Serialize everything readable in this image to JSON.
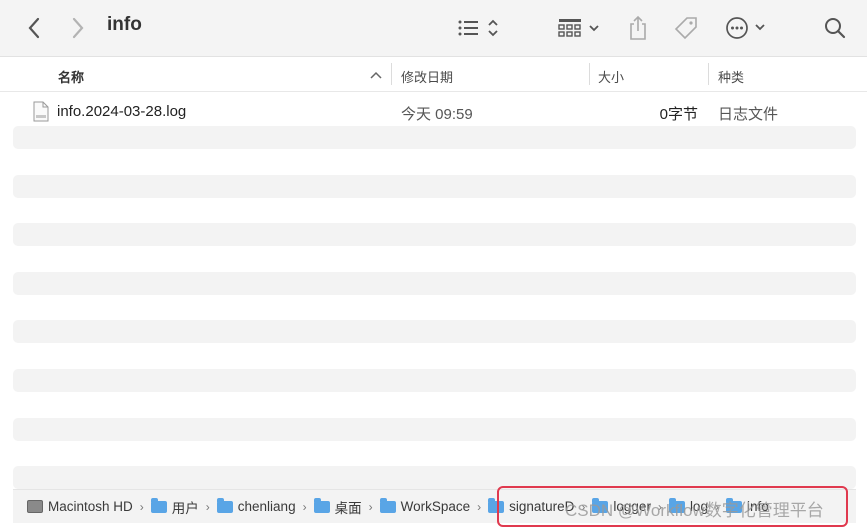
{
  "window": {
    "title": "info"
  },
  "toolbar": {
    "back_icon": "chevron-left-icon",
    "forward_icon": "chevron-right-icon",
    "view_list_icon": "list-view-icon",
    "group_icon": "grid-group-icon",
    "share_icon": "share-icon",
    "tag_icon": "tag-icon",
    "more_icon": "ellipsis-circle-icon",
    "search_icon": "search-icon"
  },
  "columns": {
    "name": "名称",
    "modified": "修改日期",
    "size": "大小",
    "kind": "种类"
  },
  "files": [
    {
      "name": "info.2024-03-28.log",
      "modified": "今天 09:59",
      "size": "0字节",
      "kind": "日志文件"
    }
  ],
  "pathbar": {
    "items": [
      {
        "label": "Macintosh HD",
        "icon": "hard-drive-icon"
      },
      {
        "label": "用户",
        "icon": "folder-icon"
      },
      {
        "label": "chenliang",
        "icon": "home-folder-icon"
      },
      {
        "label": "桌面",
        "icon": "folder-icon"
      },
      {
        "label": "WorkSpace",
        "icon": "folder-icon"
      },
      {
        "label": "signatureD",
        "icon": "folder-icon"
      },
      {
        "label": "logger",
        "icon": "folder-icon"
      },
      {
        "label": "log",
        "icon": "folder-icon"
      },
      {
        "label": "info",
        "icon": "folder-icon"
      }
    ]
  },
  "watermark": "CSDN @Workflow数字化管理平台",
  "colors": {
    "highlight": "#e0394e",
    "folder": "#59a5e6"
  }
}
